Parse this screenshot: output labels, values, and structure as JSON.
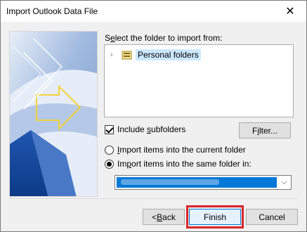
{
  "window": {
    "title": "Import Outlook Data File",
    "close_glyph": "✕"
  },
  "prompt": {
    "pre": "S",
    "accel": "e",
    "post": "lect the folder to import from:"
  },
  "tree": {
    "chevron": "›",
    "items": [
      {
        "label": "Personal folders",
        "selected": true
      }
    ]
  },
  "options": {
    "include_subfolders": {
      "pre": "Include ",
      "accel": "s",
      "post": "ubfolders",
      "checked": true
    },
    "filter_button": {
      "pre": "F",
      "accel": "i",
      "post": "lter..."
    },
    "radio_current": {
      "pre": "",
      "accel": "I",
      "post": "mport items into the current folder",
      "checked": false
    },
    "radio_same": {
      "pre": "Im",
      "accel": "p",
      "post": "ort items into the same folder in:",
      "checked": true
    },
    "combo_arrow": "⌵"
  },
  "buttons": {
    "back": {
      "pre": "< ",
      "accel": "B",
      "post": "ack"
    },
    "finish": "Finish",
    "cancel": "Cancel"
  },
  "colors": {
    "accent": "#0078d7",
    "highlight_box": "#d9262b"
  }
}
